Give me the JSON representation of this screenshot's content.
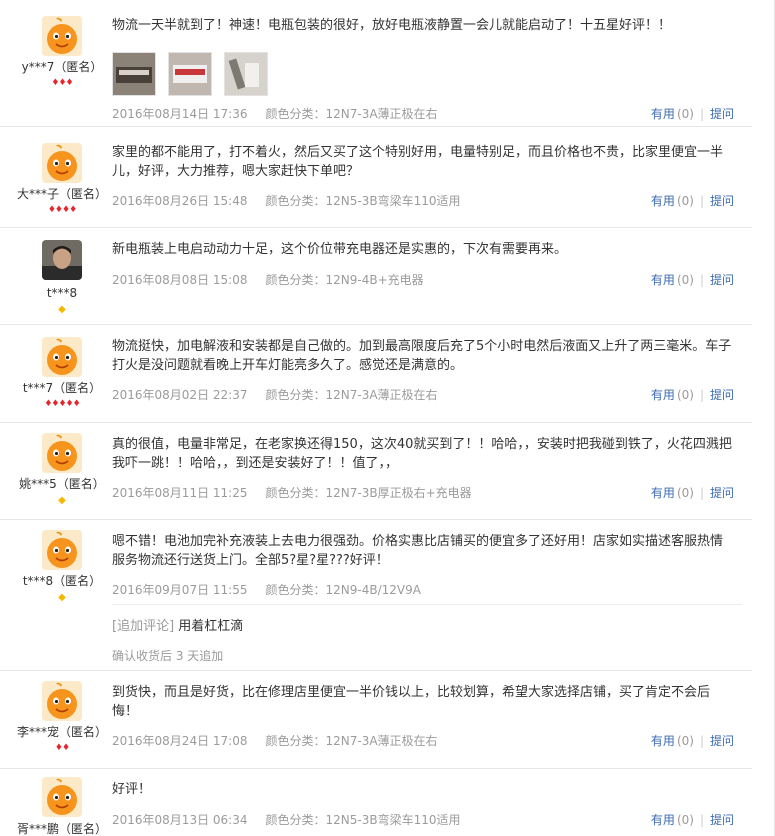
{
  "reviews": [
    {
      "user": "y***7（匿名）",
      "rank": "♦♦♦",
      "content": "物流一天半就到了！神速！电瓶包装的很好，放好电瓶液静置一会儿就能启动了！十五星好评！！",
      "date": "2016年08月14日 17:36",
      "spec": "颜色分类：12N7-3A薄正极在右",
      "useful": "有用",
      "count": "(0)",
      "reply": "提问"
    },
    {
      "user": "大***子（匿名）",
      "rank": "♦♦♦♦",
      "content": "家里的都不能用了，打不着火，然后又买了这个特别好用，电量特别足，而且价格也不贵，比家里便宜一半儿，好评，大力推荐，嗯大家赶快下单吧？",
      "date": "2016年08月26日 15:48",
      "spec": "颜色分类：12N5-3B弯梁车110适用",
      "useful": "有用",
      "count": "(0)",
      "reply": "提问"
    },
    {
      "user": "t***8",
      "rank": "◆",
      "content": "新电瓶装上电启动动力十足，这个价位带充电器还是实惠的，下次有需要再来。",
      "date": "2016年08月08日 15:08",
      "spec": "颜色分类：12N9-4B+充电器",
      "useful": "有用",
      "count": "(0)",
      "reply": "提问"
    },
    {
      "user": "t***7（匿名）",
      "rank": "♦♦♦♦♦",
      "content": "物流挺快，加电解液和安装都是自己做的。加到最高限度后充了5个小时电然后液面又上升了两三毫米。车子打火是没问题就看晚上开车灯能亮多久了。感觉还是满意的。",
      "date": "2016年08月02日 22:37",
      "spec": "颜色分类：12N7-3A薄正极在右",
      "useful": "有用",
      "count": "(0)",
      "reply": "提问"
    },
    {
      "user": "姚***5（匿名）",
      "rank": "◆",
      "content": "真的很值，电量非常足，在老家换还得150，这次40就买到了！！哈哈，，安装时把我碰到铁了，火花四溅把我吓一跳！！哈哈，，到还是安装好了！！值了，，",
      "date": "2016年08月11日 11:25",
      "spec": "颜色分类：12N7-3B厚正极右+充电器",
      "useful": "有用",
      "count": "(0)",
      "reply": "提问"
    },
    {
      "user": "t***8（匿名）",
      "rank": "◆",
      "content": "嗯不错！电池加完补充液装上去电力很强劲。价格实惠比店铺买的便宜多了还好用！店家如实描述客服热情服务物流还行送货上门。全部5?星?星???好评！",
      "date": "2016年09月07日 11:55",
      "spec": "颜色分类：12N9-4B/12V9A",
      "append_tag": "[追加评论]",
      "append_text": "用着杠杠滴",
      "append_time": "确认收货后 3 天追加"
    },
    {
      "user": "李***宠（匿名）",
      "rank": "♦♦",
      "content": "到货快，而且是好货，比在修理店里便宜一半价钱以上，比较划算，希望大家选择店铺，买了肯定不会后悔！",
      "date": "2016年08月24日 17:08",
      "spec": "颜色分类：12N7-3A薄正极在右",
      "useful": "有用",
      "count": "(0)",
      "reply": "提问"
    },
    {
      "user": "胥***鹏（匿名）",
      "content": "好评！",
      "date": "2016年08月13日 06:34",
      "spec": "颜色分类：12N5-3B弯梁车110适用",
      "useful": "有用",
      "count": "(0)",
      "reply": "提问"
    }
  ],
  "colors": {
    "link": "#3b6bb1",
    "meta": "#9b9b9b",
    "rank_heart": "#e8252b",
    "rank_diamond": "#f5b700"
  }
}
